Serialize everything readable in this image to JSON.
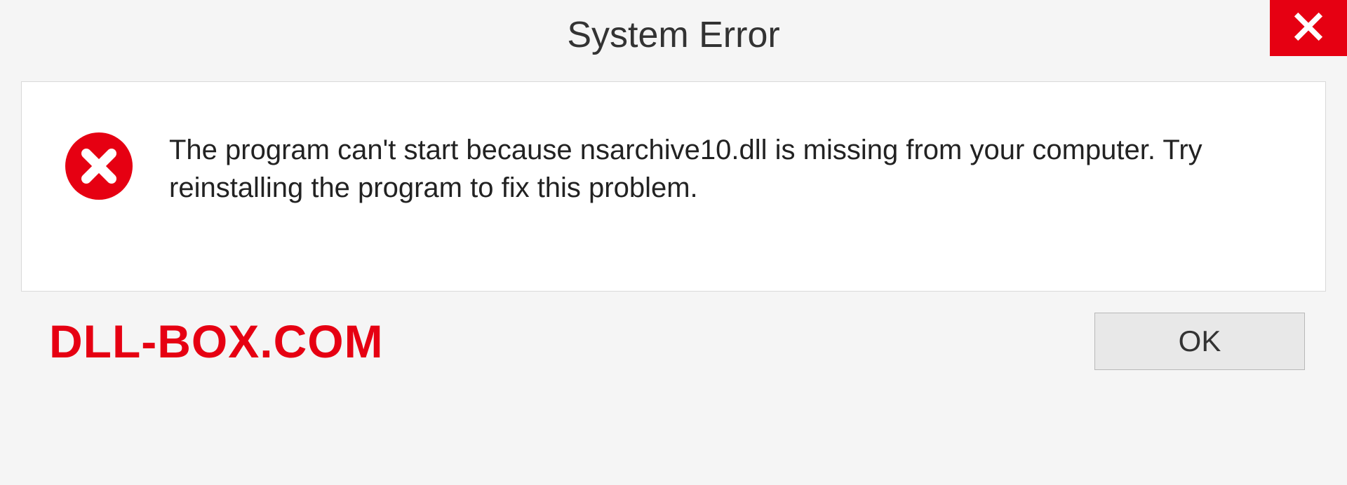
{
  "dialog": {
    "title": "System Error",
    "message": "The program can't start because nsarchive10.dll is missing from your computer. Try reinstalling the program to fix this problem.",
    "ok_label": "OK"
  },
  "watermark": "DLL-BOX.COM",
  "colors": {
    "accent_red": "#e60012"
  }
}
